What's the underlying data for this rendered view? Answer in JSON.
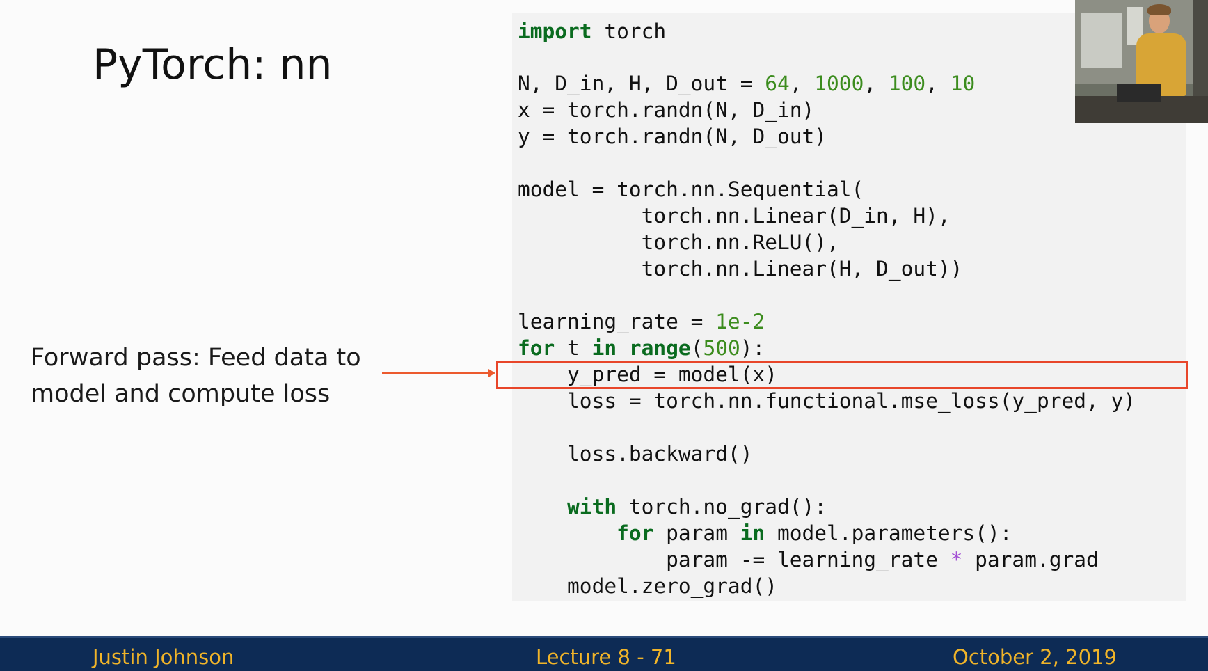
{
  "slide": {
    "title": "PyTorch: nn",
    "callout": {
      "line1": "Forward pass: Feed data to",
      "line2": "model and compute loss"
    }
  },
  "code": {
    "line01": {
      "kw": "import",
      "rest": " torch"
    },
    "line03": {
      "a": "N, D_in, H, D_out = ",
      "n1": "64",
      "s1": ", ",
      "n2": "1000",
      "s2": ", ",
      "n3": "100",
      "s3": ", ",
      "n4": "10"
    },
    "line04": "x = torch.randn(N, D_in)",
    "line05": "y = torch.randn(N, D_out)",
    "line07": "model = torch.nn.Sequential(",
    "line08": "          torch.nn.Linear(D_in, H),",
    "line09": "          torch.nn.ReLU(),",
    "line10": "          torch.nn.Linear(H, D_out))",
    "line12": {
      "a": "learning_rate = ",
      "n": "1e-2"
    },
    "line13": {
      "kw1": "for",
      "a": " t ",
      "kw2": "in",
      "b": " ",
      "kw3": "range",
      "c": "(",
      "n": "500",
      "d": "):"
    },
    "line14": "    y_pred = model(x)",
    "line15": "    loss = torch.nn.functional.mse_loss(y_pred, y)",
    "line17": "    loss.backward()",
    "line19": {
      "indent": "    ",
      "kw": "with",
      "rest": " torch.no_grad():"
    },
    "line20": {
      "indent": "        ",
      "kw1": "for",
      "a": " param ",
      "kw2": "in",
      "rest": " model.parameters():"
    },
    "line21": {
      "a": "            param -= learning_rate ",
      "op": "*",
      "b": " param.grad"
    },
    "line22": "    model.zero_grad()"
  },
  "footer": {
    "author": "Justin Johnson",
    "lecture": "Lecture 8 - 71",
    "date": "October 2, 2019"
  },
  "colors": {
    "keyword": "#0a6b1f",
    "number": "#3c8c1e",
    "operator": "#a24fd4",
    "highlight": "#e8462a",
    "footer_bg": "#0d2b55",
    "footer_text": "#f0b429"
  }
}
